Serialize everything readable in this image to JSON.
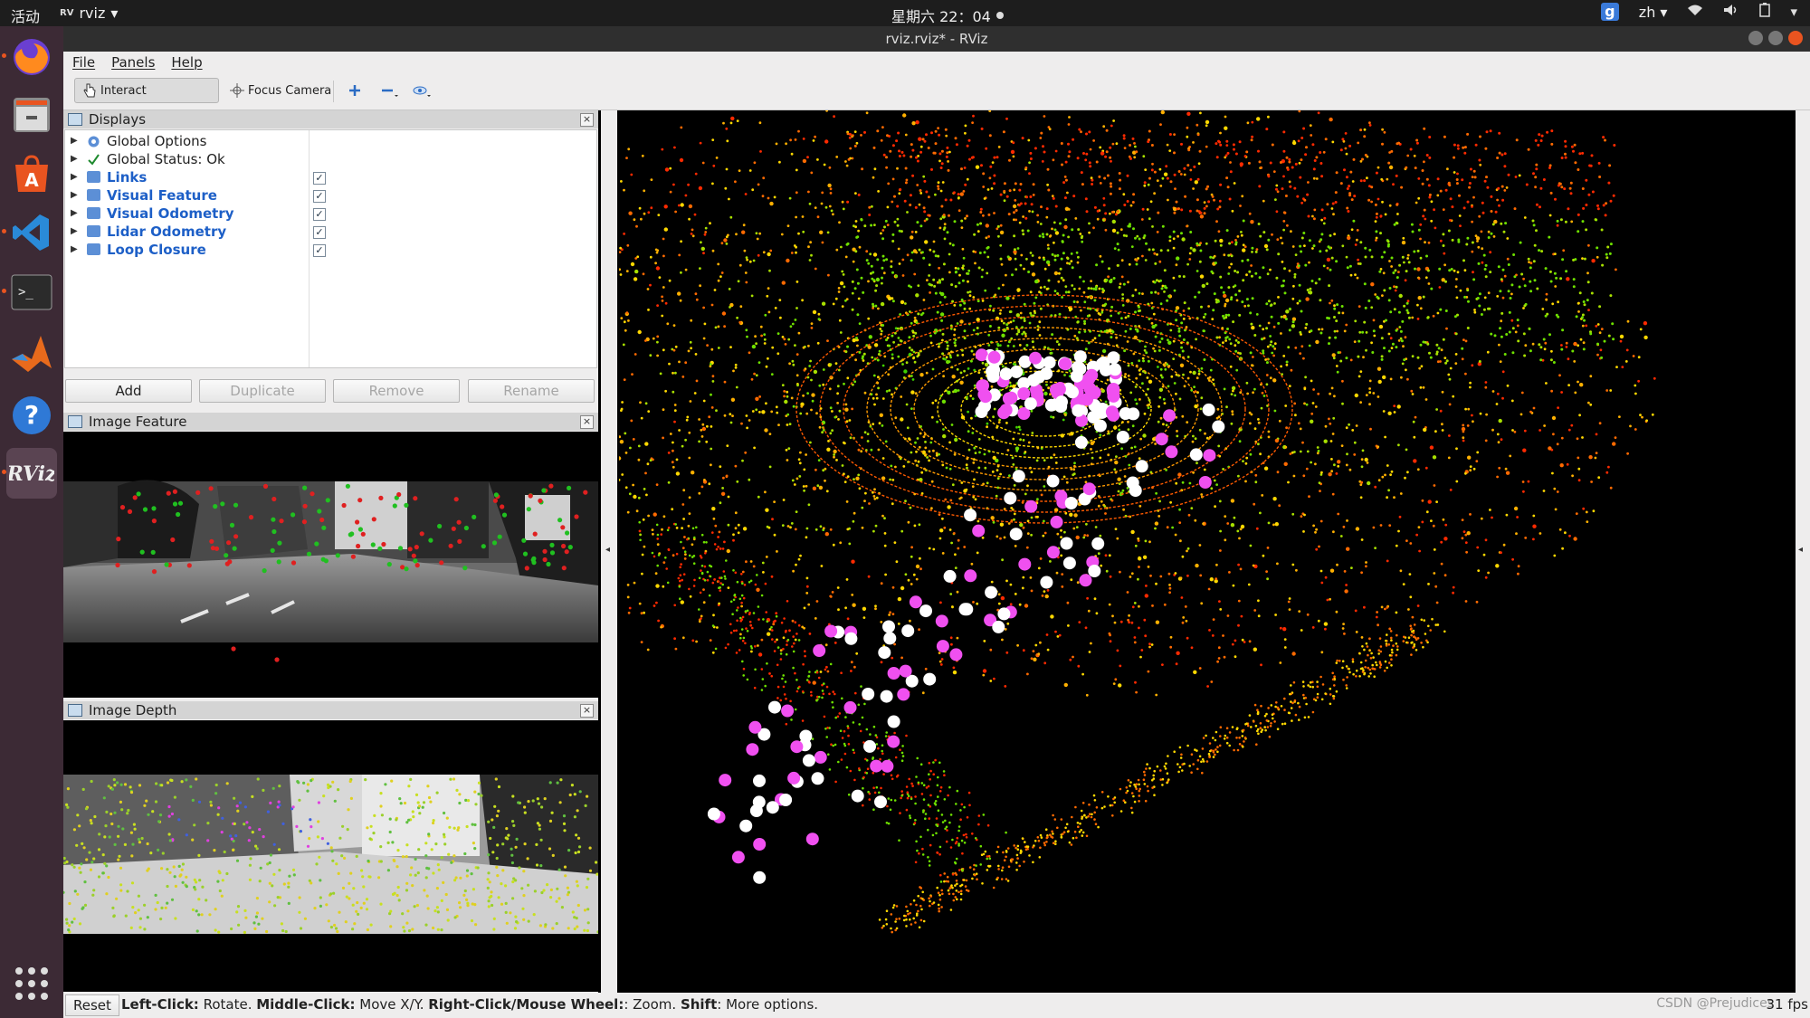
{
  "topbar": {
    "activities": "活动",
    "app_name": "rviz",
    "app_badge": "RViz",
    "clock": "星期六 22：04",
    "input_method_badge": "g",
    "language": "zh"
  },
  "window": {
    "title": "rviz.rviz* - RViz"
  },
  "menubar": {
    "file": "File",
    "panels": "Panels",
    "help": "Help"
  },
  "toolbar": {
    "interact": "Interact",
    "focus_camera": "Focus Camera"
  },
  "displays_panel": {
    "title": "Displays",
    "items": [
      {
        "label": "Global Options",
        "checkbox": false,
        "style": "plain",
        "icon": "gear-icon"
      },
      {
        "label": "Global Status: Ok",
        "checkbox": false,
        "style": "plain",
        "icon": "check-icon"
      },
      {
        "label": "Links",
        "checkbox": true,
        "checked": true,
        "style": "blue",
        "icon": "folder-icon"
      },
      {
        "label": "Visual Feature",
        "checkbox": true,
        "checked": true,
        "style": "blue",
        "icon": "folder-icon"
      },
      {
        "label": "Visual Odometry",
        "checkbox": true,
        "checked": true,
        "style": "blue",
        "icon": "folder-icon"
      },
      {
        "label": "Lidar Odometry",
        "checkbox": true,
        "checked": true,
        "style": "blue",
        "icon": "folder-icon"
      },
      {
        "label": "Loop Closure",
        "checkbox": true,
        "checked": true,
        "style": "blue",
        "icon": "folder-icon"
      }
    ],
    "buttons": {
      "add": "Add",
      "duplicate": "Duplicate",
      "remove": "Remove",
      "rename": "Rename"
    }
  },
  "image_feature_panel": {
    "title": "Image Feature"
  },
  "image_depth_panel": {
    "title": "Image Depth"
  },
  "statusbar": {
    "reset": "Reset",
    "help_parts": [
      {
        "b": "Left-Click:",
        "t": " Rotate. "
      },
      {
        "b": "Middle-Click:",
        "t": " Move X/Y. "
      },
      {
        "b": "Right-Click/Mouse Wheel:",
        "t": ": Zoom. "
      },
      {
        "b": "Shift",
        "t": ": More options."
      }
    ],
    "watermark": "CSDN @Prejudices",
    "fps": "31 fps"
  },
  "colors": {
    "feature_point_white": "#ffffff",
    "feature_point_magenta": "#f050f0",
    "cloud_near": "#ffd000",
    "cloud_mid": "#6ee000",
    "cloud_far": "#ff2a00"
  }
}
